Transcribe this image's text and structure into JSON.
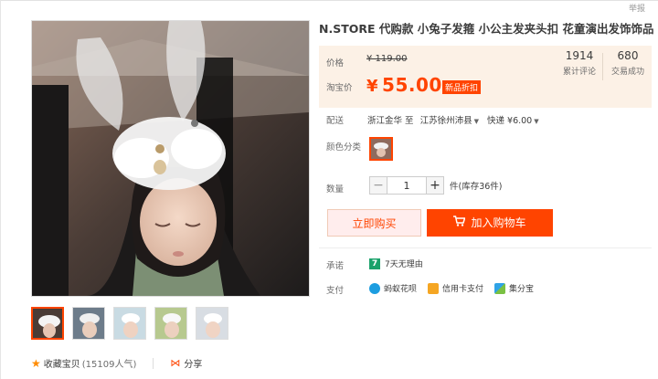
{
  "report": "举报",
  "title": "N.STORE 代购款 小兔子发箍 小公主发夹头扣 花童演出发饰饰品",
  "price": {
    "label": "价格",
    "original": "¥ 119.00",
    "tb_label": "淘宝价",
    "current_yen": "¥",
    "current": "55.00",
    "promo": "新品折扣"
  },
  "stats": {
    "reviews_num": "1914",
    "reviews_label": "累计评论",
    "deals_num": "680",
    "deals_label": "交易成功"
  },
  "delivery": {
    "label": "配送",
    "origin": "浙江金华 至",
    "destination": "江苏徐州沛县",
    "method": "快递 ¥6.00"
  },
  "color": {
    "label": "颜色分类"
  },
  "quantity": {
    "label": "数量",
    "value": "1",
    "minus": "−",
    "plus": "+",
    "stock": "件(库存36件)"
  },
  "actions": {
    "buy_now": "立即购买",
    "add_cart": "加入购物车"
  },
  "promise": {
    "label": "承诺",
    "badge": "7",
    "text": "7天无理由"
  },
  "payment": {
    "label": "支付",
    "items": [
      "蚂蚁花呗",
      "信用卡支付",
      "集分宝"
    ]
  },
  "footer": {
    "favorite": "收藏宝贝",
    "popularity": "(15109人气)",
    "share": "分享"
  },
  "colors": {
    "accent": "#ff4400",
    "price_bg": "#fcf1e6",
    "green_badge": "#1ba26b"
  }
}
